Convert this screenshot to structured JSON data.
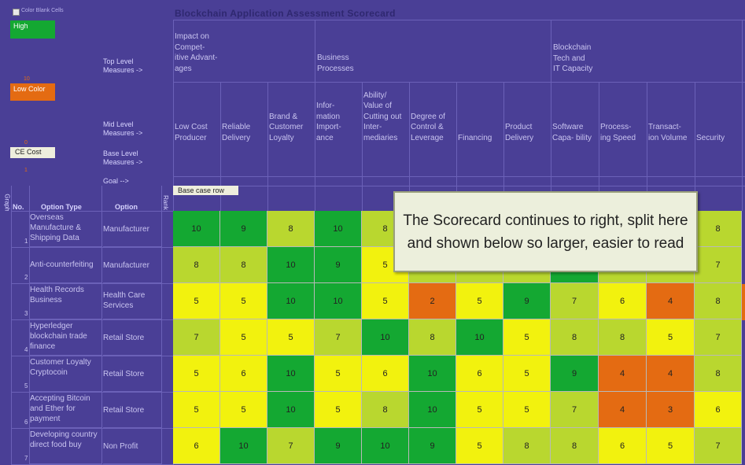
{
  "title": "Blockchain Application Assessment  Scorecard",
  "legend": {
    "checkbox_label": "Color Blank Cells",
    "high": "High",
    "low": "Low Color",
    "ce": "CE Cost",
    "n10": "10",
    "n0": "0",
    "n1": "1"
  },
  "row_headers": {
    "top": "Top Level\nMeasures ->",
    "mid": "Mid Level\nMeasures ->",
    "base": "Base Level\nMeasures ->",
    "goal": "Goal -->"
  },
  "columns_top": [
    {
      "label": "Impact on\nCompet-\nitive Advant-\nages"
    },
    {
      "label": "Business\nProcesses"
    },
    {
      "label": "Blockchain\nTech and\nIT Capacity"
    }
  ],
  "columns_mid": [
    "Low Cost\nProducer",
    "Reliable\nDelivery",
    "Brand &\nCustomer\nLoyalty",
    "Infor-\nmation\nImport-\nance",
    "Ability/\nValue of\nCutting out\nInter-\nmediaries",
    "Degree of\nControl &\nLeverage",
    "Financing",
    "Product\nDelivery",
    "Software\nCapa- bility",
    "Process-\ning Speed",
    "Transact-\nion Volume",
    "Security"
  ],
  "base_case_label": "Base case row",
  "table_headers": {
    "no": "No.",
    "option_type": "Option Type",
    "option": "Option",
    "rank": "Rank",
    "graph": "Graph"
  },
  "callout": "The Scorecard continues to right, split here and shown below so larger, easier to read",
  "colors": {
    "dark_green": "#14a832",
    "light_green": "#b9d72f",
    "yellow": "#f2f20e",
    "orange": "#e46b12",
    "background": "#4a3f96"
  },
  "rows": [
    {
      "no": "1",
      "option_type": "Overseas Manufacture & Shipping Data",
      "option": "Manufacturer",
      "scores": [
        "10",
        "9",
        "8",
        "10",
        "8",
        "",
        "",
        "",
        "",
        "",
        "",
        "",
        "8"
      ],
      "colors": [
        "dg",
        "dg",
        "lg",
        "dg",
        "lg",
        "",
        "",
        "",
        "",
        "",
        "",
        "",
        "lg"
      ]
    },
    {
      "no": "2",
      "option_type": "Anti-counterfeiting",
      "option": "Manufacturer",
      "scores": [
        "8",
        "8",
        "10",
        "9",
        "5",
        "",
        "",
        "",
        "",
        "",
        "",
        "",
        "7"
      ],
      "colors": [
        "lg",
        "lg",
        "dg",
        "dg",
        "y",
        "",
        "",
        "",
        "",
        "",
        "",
        "",
        "lg"
      ]
    },
    {
      "no": "3",
      "option_type": "Health Records Business",
      "option": "Health Care Services",
      "scores": [
        "5",
        "5",
        "10",
        "10",
        "5",
        "2",
        "5",
        "9",
        "7",
        "6",
        "4",
        "8"
      ],
      "colors": [
        "y",
        "y",
        "dg",
        "dg",
        "y",
        "o",
        "y",
        "dg",
        "lg",
        "y",
        "o",
        "lg"
      ]
    },
    {
      "no": "4",
      "option_type": "Hyperledger blockchain trade finance",
      "option": "Retail Store",
      "scores": [
        "7",
        "5",
        "5",
        "7",
        "10",
        "8",
        "10",
        "5",
        "8",
        "8",
        "5",
        "7"
      ],
      "colors": [
        "lg",
        "y",
        "y",
        "lg",
        "dg",
        "lg",
        "dg",
        "y",
        "lg",
        "lg",
        "y",
        "lg"
      ]
    },
    {
      "no": "5",
      "option_type": "Customer Loyalty Cryptocoin",
      "option": "Retail Store",
      "scores": [
        "5",
        "6",
        "10",
        "5",
        "6",
        "10",
        "6",
        "5",
        "9",
        "4",
        "4",
        "8"
      ],
      "colors": [
        "y",
        "y",
        "dg",
        "y",
        "y",
        "dg",
        "y",
        "y",
        "dg",
        "o",
        "o",
        "lg"
      ]
    },
    {
      "no": "6",
      "option_type": "Accepting Bitcoin and Ether for payment",
      "option": "Retail Store",
      "scores": [
        "5",
        "5",
        "10",
        "5",
        "8",
        "10",
        "5",
        "5",
        "7",
        "4",
        "3",
        "6"
      ],
      "colors": [
        "y",
        "y",
        "dg",
        "y",
        "lg",
        "dg",
        "y",
        "y",
        "lg",
        "o",
        "o",
        "y"
      ]
    },
    {
      "no": "7",
      "option_type": "Developing country direct food buy",
      "option": "Non Profit",
      "scores": [
        "6",
        "10",
        "7",
        "9",
        "10",
        "9",
        "5",
        "8",
        "8",
        "6",
        "5",
        "7"
      ],
      "colors": [
        "y",
        "dg",
        "lg",
        "dg",
        "dg",
        "dg",
        "y",
        "lg",
        "lg",
        "y",
        "y",
        "lg"
      ]
    }
  ]
}
